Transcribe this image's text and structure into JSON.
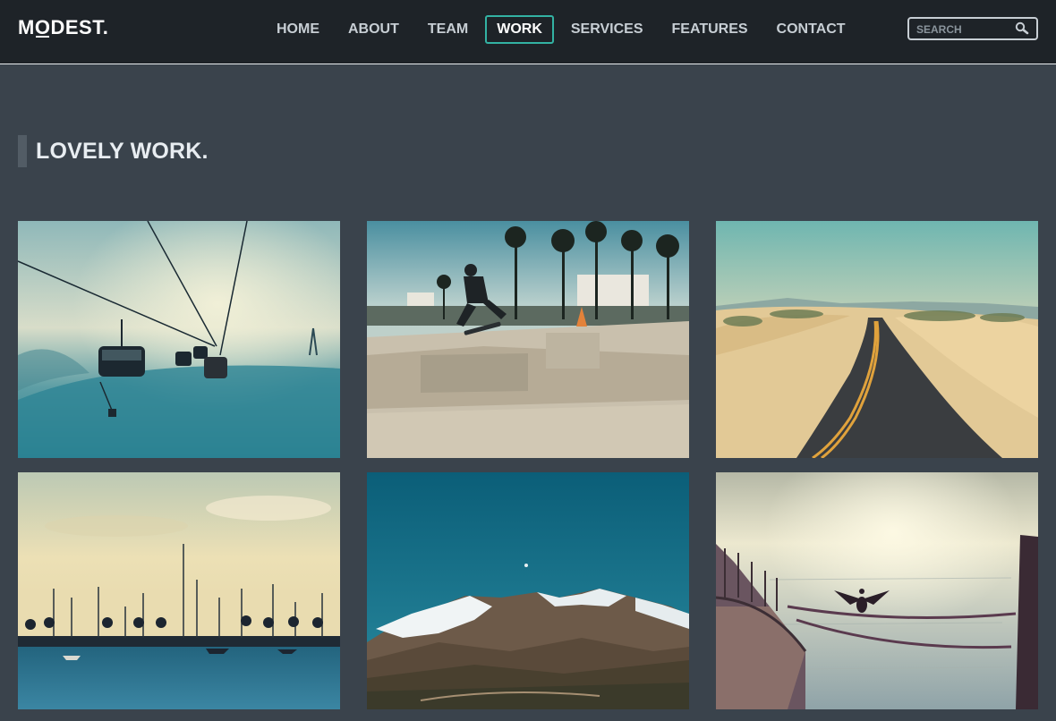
{
  "brand": {
    "logo": "MODEST."
  },
  "nav": {
    "items": [
      {
        "label": "HOME"
      },
      {
        "label": "ABOUT"
      },
      {
        "label": "TEAM"
      },
      {
        "label": "WORK"
      },
      {
        "label": "SERVICES"
      },
      {
        "label": "FEATURES"
      },
      {
        "label": "CONTACT"
      }
    ],
    "active": "WORK"
  },
  "search": {
    "placeholder": "SEARCH",
    "value": ""
  },
  "section": {
    "title": "LOVELY WORK."
  },
  "colors": {
    "accent": "#33b2a3",
    "background": "#3a434c",
    "navbar": "#1e2328"
  },
  "icons": {
    "search": "search-icon"
  }
}
